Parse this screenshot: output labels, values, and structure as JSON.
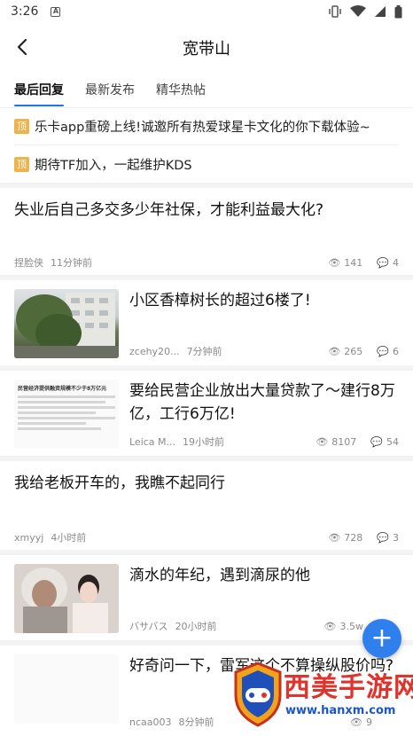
{
  "status_bar": {
    "time": "3:26",
    "sim_label": "A"
  },
  "header": {
    "title": "宽带山"
  },
  "tabs": [
    {
      "label": "最后回复",
      "active": true
    },
    {
      "label": "最新发布",
      "active": false
    },
    {
      "label": "精华热帖",
      "active": false
    }
  ],
  "pinned": [
    {
      "badge": "顶",
      "text": "乐卡app重磅上线!诚邀所有热爱球星卡文化的你下载体验~"
    },
    {
      "badge": "顶",
      "text": "期待TF加入，一起维护KDS"
    }
  ],
  "posts": [
    {
      "title": "失业后自己多交多少年社保，才能利益最大化?",
      "author": "捏脸侠",
      "time": "11分钟前",
      "views": "141",
      "comments": "4",
      "thumb": null
    },
    {
      "title": "小区香樟树长的超过6楼了!",
      "author": "zcehy20...",
      "time": "7分钟前",
      "views": "265",
      "comments": "6",
      "thumb": "tree-photo"
    },
    {
      "title": "要给民营企业放出大量贷款了～建行8万亿，工行6万亿!",
      "author": "Leica M...",
      "time": "19小时前",
      "views": "8107",
      "comments": "54",
      "thumb": "news-article",
      "thumb_title": "民营经济提供融资规模不少于8万亿元"
    },
    {
      "title": "我给老板开车的，我瞧不起同行",
      "author": "xmyyj",
      "time": "4小时前",
      "views": "728",
      "comments": "3",
      "thumb": null
    },
    {
      "title": "滴水的年纪，遇到滴尿的他",
      "author": "バサバス",
      "time": "20小时前",
      "views": "3.5w",
      "comments": "",
      "thumb": "couple-photo"
    },
    {
      "title": "好奇问一下，雷军这个不算操纵股价吗?",
      "author": "ncaa003",
      "time": "8分钟前",
      "views": "9",
      "comments": "",
      "thumb": "stock-article"
    }
  ],
  "fab": {
    "label": "+"
  },
  "watermark": {
    "text": "西美手游网",
    "url": "www.hanxm.com"
  },
  "colors": {
    "accent": "#1a73e8",
    "fab": "#2f80ed",
    "pin_badge": "#f0b24a",
    "watermark_red": "#e0332c",
    "watermark_blue": "#1a56c8"
  }
}
